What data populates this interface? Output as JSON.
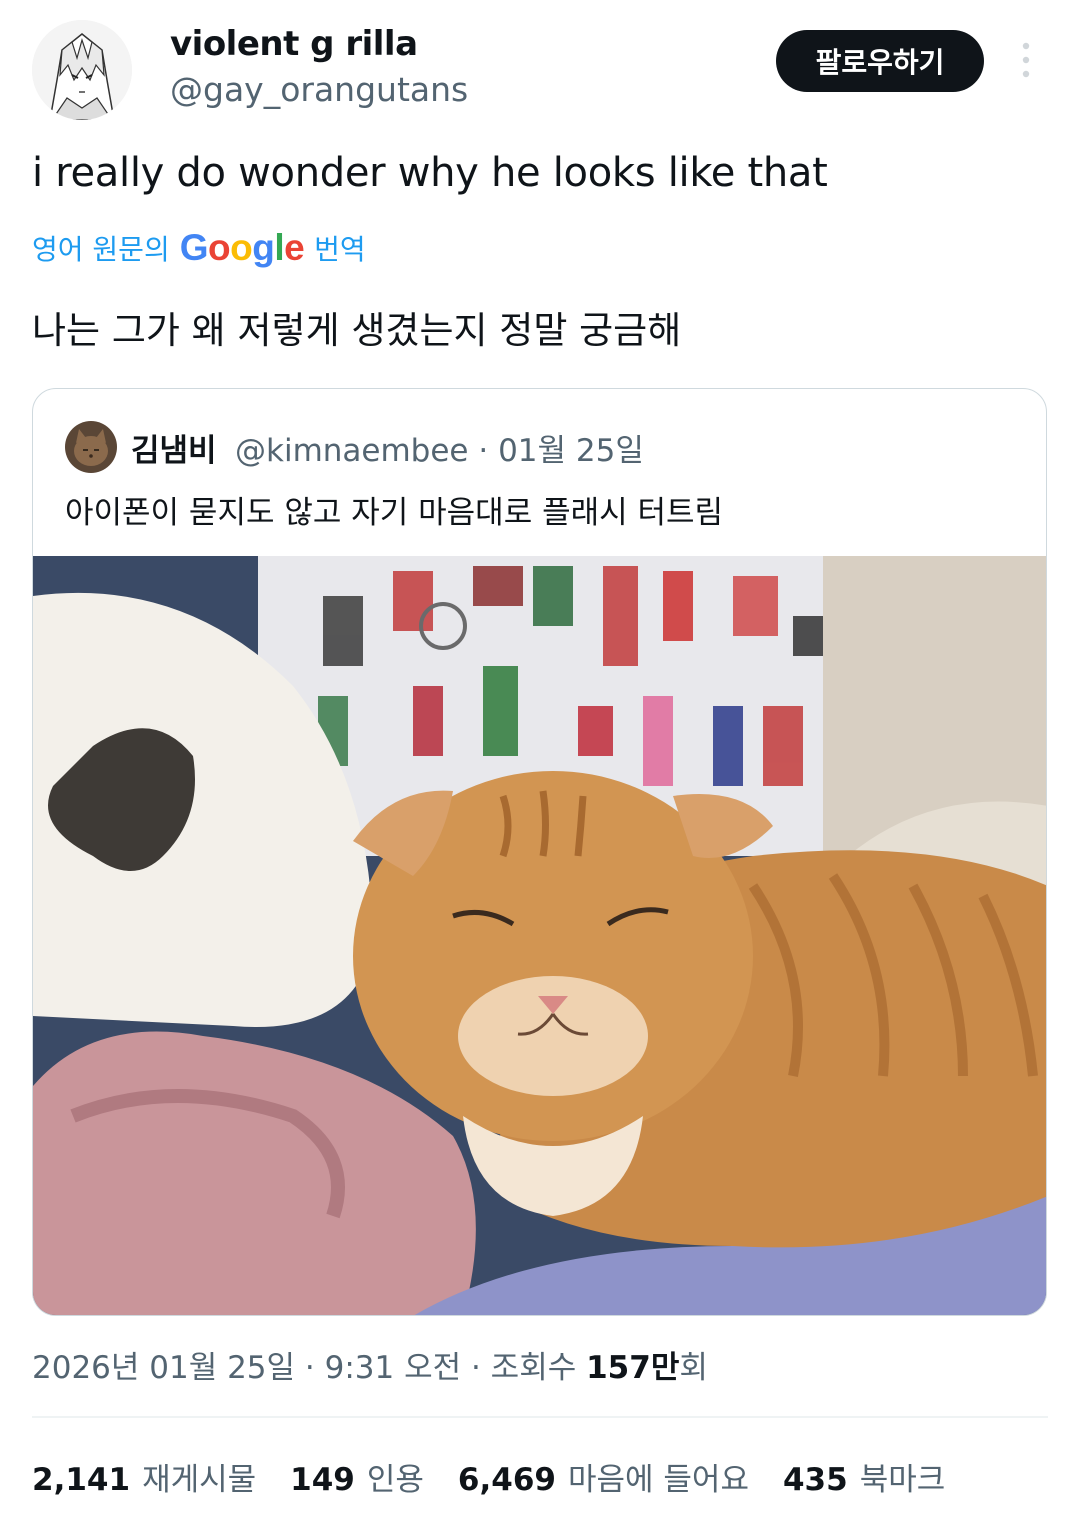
{
  "author": {
    "display_name": "violent g rilla",
    "handle": "@gay_orangutans",
    "avatar_icon": "anime-character-avatar"
  },
  "follow_label": "팔로우하기",
  "tweet_text": "i really do wonder why he looks like that",
  "translation": {
    "prefix": "영어 원문의",
    "google_letters": [
      "G",
      "o",
      "o",
      "g",
      "l",
      "e"
    ],
    "google_colors": [
      "#4285F4",
      "#EA4335",
      "#FBBC05",
      "#4285F4",
      "#34A853",
      "#EA4335"
    ],
    "action": "번역",
    "text": "나는 그가 왜 저렇게 생겼는지 정말 궁금해"
  },
  "quote": {
    "display_name": "김냄비",
    "handle": "@kimnaembee",
    "date": "· 01월 25일",
    "text": "아이폰이 묻지도 않고 자기 마음대로 플래시 터트림",
    "image_icon": "ginger-cat-photo"
  },
  "meta": {
    "timestamp": "2026년 01월 25일 · 9:31 오전 · 조회수",
    "views_number": "157만",
    "views_suffix": "회"
  },
  "stats": [
    {
      "count": "2,141",
      "label": "재게시물"
    },
    {
      "count": "149",
      "label": "인용"
    },
    {
      "count": "6,469",
      "label": "마음에 들어요"
    },
    {
      "count": "435",
      "label": "북마크"
    }
  ],
  "colors": {
    "link_blue": "#1d9bf0",
    "secondary_text": "#536471",
    "primary_text": "#0f1419",
    "follow_button_bg": "#0f1419"
  }
}
